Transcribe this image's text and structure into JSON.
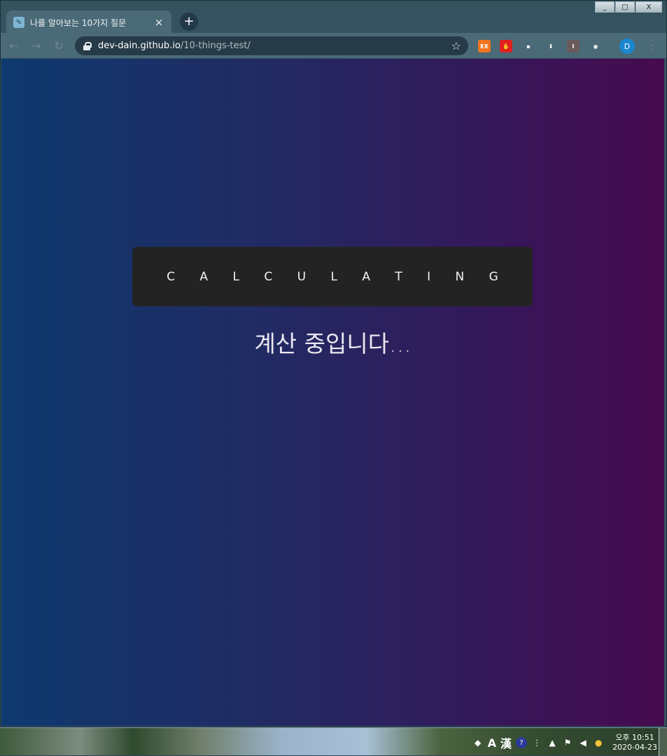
{
  "window": {
    "controls": {
      "minimize": "_",
      "maximize": "□",
      "close": "X"
    }
  },
  "tab": {
    "title": "나를 알아보는 10가지 질문",
    "close": "×",
    "new_tab": "+"
  },
  "toolbar": {
    "url_host": "dev-dain.github.io",
    "url_path": "/10-things-test/",
    "star": "☆",
    "profile_initial": "D",
    "extensions": [
      {
        "name": "ex-extension",
        "label": "EX",
        "color": "#f2731f"
      },
      {
        "name": "stop-extension",
        "label": "✋",
        "color": "#e02020"
      },
      {
        "name": "picture-extension",
        "label": "▪",
        "color": "#4a6a78"
      },
      {
        "name": "download-extension",
        "label": "⬇",
        "color": "#4a6a78"
      },
      {
        "name": "i-extension",
        "label": "I",
        "color": "#6a5a5a"
      },
      {
        "name": "eye-extension",
        "label": "◉",
        "color": "#4a6a78"
      }
    ]
  },
  "page": {
    "calc_title": "C A L C U L A T I N G",
    "status": "계산 중입니다...",
    "gradient": [
      "#0e3a6e",
      "#470a4f"
    ]
  },
  "taskbar": {
    "ime_a": "A",
    "ime_han": "漢",
    "time": "오후 10:51",
    "date": "2020-04-23"
  }
}
